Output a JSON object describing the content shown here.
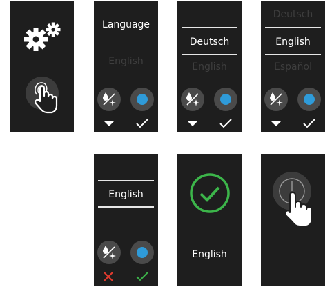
{
  "colors": {
    "screen_bg": "#1e1e1e",
    "text": "#ffffff",
    "text_dim": "#3e3e3e",
    "accent_blue": "#2f9bd9",
    "confirm_green": "#3cb54a",
    "cancel_red": "#e23b2e"
  },
  "screens": {
    "s1": {
      "icons": [
        "gears-icon",
        "touch-hand-icon"
      ]
    },
    "s2": {
      "heading": "Language",
      "option_dim": "English"
    },
    "s3": {
      "option_prev": "",
      "option_selected": "Deutsch",
      "option_next": "English"
    },
    "s4": {
      "option_prev": "Deutsch",
      "option_selected": "English",
      "option_next": "Español"
    },
    "s5": {
      "option_selected": "English"
    },
    "s6": {
      "confirmation": "English"
    },
    "s7": {
      "icons": [
        "power-icon",
        "tap-hand-icon"
      ]
    }
  }
}
